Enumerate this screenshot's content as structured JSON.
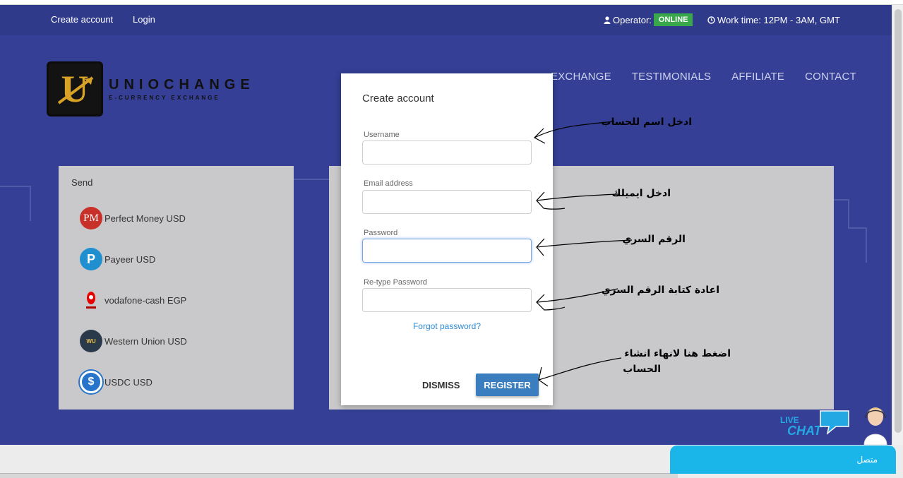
{
  "topbar": {
    "create_account": "Create account",
    "login": "Login",
    "operator_label": "Operator:",
    "operator_status": "ONLINE",
    "work_time": "Work time: 12PM - 3AM, GMT"
  },
  "brand": {
    "name": "UNIOCHANGE",
    "tagline": "E-CURRENCY EXCHANGE",
    "mark_letter": "U"
  },
  "nav": [
    "EXCHANGE",
    "TESTIMONIALS",
    "AFFILIATE",
    "CONTACT"
  ],
  "send_panel": {
    "title": "Send",
    "currencies": [
      {
        "label": "Perfect Money USD",
        "icon": "PM",
        "color": "#c8302a"
      },
      {
        "label": "Payeer USD",
        "icon": "P",
        "color": "#1f8fd0"
      },
      {
        "label": "vodafone-cash EGP",
        "icon": "",
        "color": "#e60000"
      },
      {
        "label": "Western Union USD",
        "icon": "WU",
        "color": "#2b3a4a"
      },
      {
        "label": "USDC USD",
        "icon": "$",
        "color": "#2775ca"
      }
    ]
  },
  "modal": {
    "title": "Create account",
    "username_label": "Username",
    "email_label": "Email address",
    "password_label": "Password",
    "retype_label": "Re-type Password",
    "forgot": "Forgot password?",
    "dismiss": "DISMISS",
    "register": "REGISTER"
  },
  "annotations": {
    "username": "ادخل اسم للحساب",
    "email": "ادخل ايميلك",
    "password": "الرقم السري",
    "retype": "اعادة كتابة الرقم السري",
    "register_line1": "اضغط هنا لانهاء انشاء",
    "register_line2": "الحساب"
  },
  "livechat": {
    "live": "LIVE",
    "chat": "CHAT",
    "status": "متصل"
  }
}
